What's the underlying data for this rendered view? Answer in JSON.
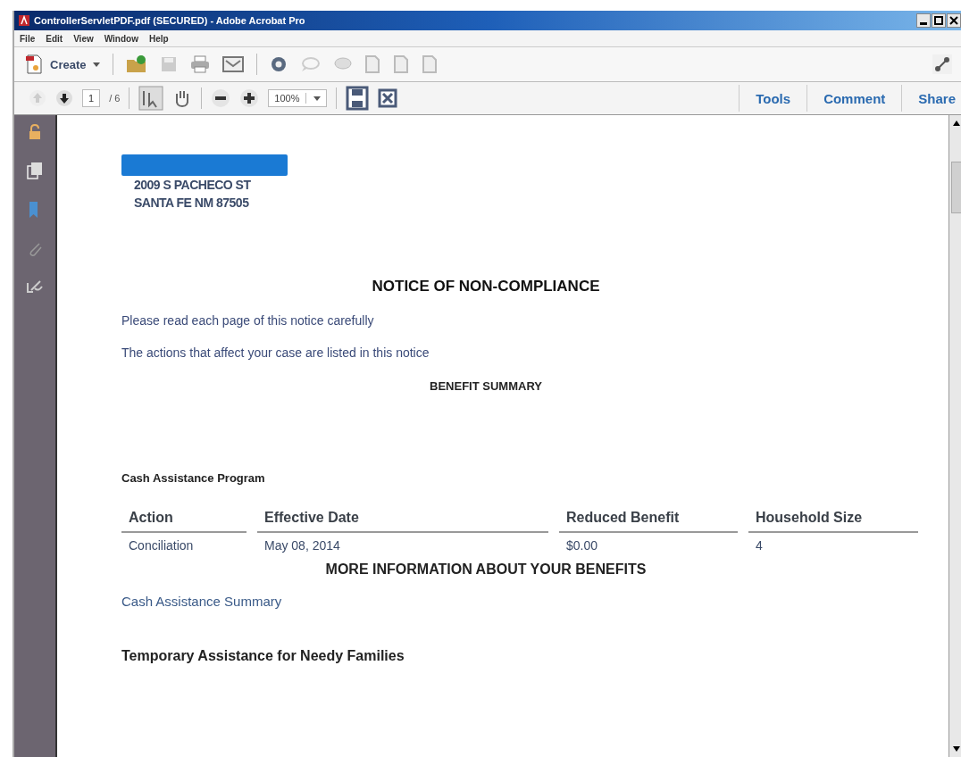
{
  "window": {
    "title": "ControllerServletPDF.pdf (SECURED) - Adobe Acrobat Pro"
  },
  "menu": [
    "File",
    "Edit",
    "View",
    "Window",
    "Help"
  ],
  "toolbar": {
    "create_label": "Create"
  },
  "navigation": {
    "page": "1",
    "page_count": "/ 6",
    "zoom": "100%"
  },
  "panels": [
    "Tools",
    "Comment",
    "Share"
  ],
  "document": {
    "address_lines": [
      "2009 S PACHECO ST",
      "SANTA FE NM 87505"
    ],
    "title": "NOTICE OF NON-COMPLIANCE",
    "intro": [
      "Please read each page of this notice carefully",
      "The actions that affect your case are listed in this notice"
    ],
    "summary_heading": "BENEFIT SUMMARY",
    "program": "Cash Assistance Program",
    "table": {
      "columns": [
        "Action",
        "Effective Date",
        "Reduced Benefit",
        "Household Size"
      ],
      "rows": [
        [
          "Conciliation",
          "May 08, 2014",
          "$0.00",
          "4"
        ]
      ]
    },
    "more_info_heading": "MORE INFORMATION ABOUT YOUR BENEFITS",
    "summary_link": "Cash Assistance Summary",
    "subsection": "Temporary Assistance for Needy Families"
  }
}
